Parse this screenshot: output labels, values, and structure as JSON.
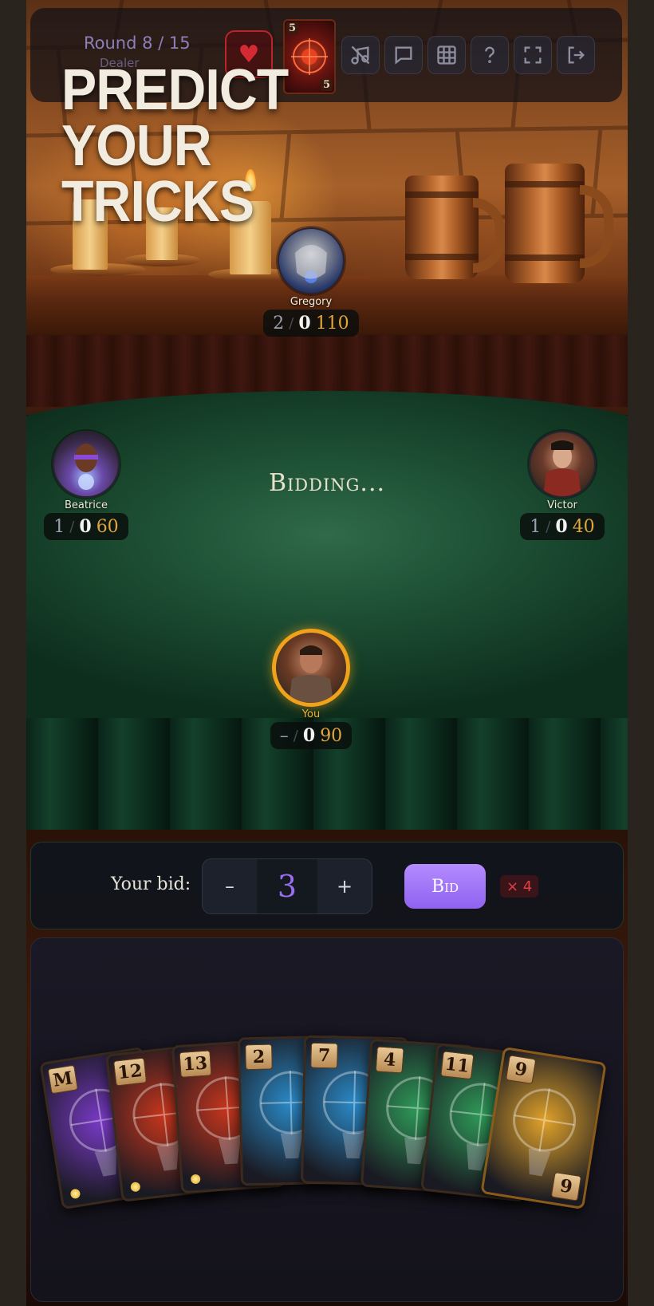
{
  "header": {
    "round_label": "Round 8 / 15",
    "dealer_label": "Dealer",
    "headline": [
      "PREDICT",
      "YOUR",
      "TRICKS"
    ],
    "trump": {
      "rank_top": "5",
      "rank_bottom": "5",
      "suit_color": "#c8301c"
    },
    "toolbar": [
      {
        "name": "mute-sound-icon",
        "icon": "music-off"
      },
      {
        "name": "chat-icon",
        "icon": "speech-bubble"
      },
      {
        "name": "scoreboard-icon",
        "icon": "grid"
      },
      {
        "name": "help-icon",
        "icon": "question-mark"
      },
      {
        "name": "fullscreen-icon",
        "icon": "expand-corners"
      },
      {
        "name": "exit-icon",
        "icon": "logout-arrow"
      }
    ]
  },
  "table": {
    "status": "Bidding..."
  },
  "players": {
    "gregory": {
      "name": "Gregory",
      "bid": "2",
      "sep": "/",
      "won": "0",
      "points": "110"
    },
    "beatrice": {
      "name": "Beatrice",
      "bid": "1",
      "sep": "/",
      "won": "0",
      "points": "60"
    },
    "victor": {
      "name": "Victor",
      "bid": "1",
      "sep": "/",
      "won": "0",
      "points": "40"
    },
    "you": {
      "name": "You",
      "bid": "–",
      "sep": "/",
      "won": "0",
      "points": "90"
    }
  },
  "bid_panel": {
    "label": "Your bid:",
    "minus": "–",
    "value": "3",
    "plus": "+",
    "submit": "Bid",
    "multiplier": "× 4"
  },
  "hand": [
    {
      "rank": "M",
      "suit": "purple",
      "color": "#7a3ac8"
    },
    {
      "rank": "12",
      "suit": "red",
      "color": "#c8361c"
    },
    {
      "rank": "13",
      "suit": "red",
      "color": "#c8361c"
    },
    {
      "rank": "2",
      "suit": "blue",
      "color": "#2a8ac8"
    },
    {
      "rank": "7",
      "suit": "blue",
      "color": "#2a8ac8"
    },
    {
      "rank": "4",
      "suit": "green",
      "color": "#2e9a58"
    },
    {
      "rank": "11",
      "suit": "green",
      "color": "#2e9a58"
    },
    {
      "rank": "9",
      "suit": "gold",
      "color": "#e0a22a"
    }
  ]
}
